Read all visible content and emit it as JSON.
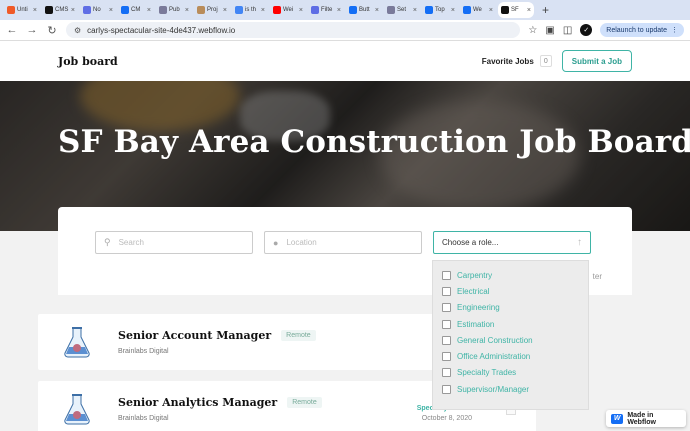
{
  "browser": {
    "tabs": [
      {
        "label": "Unti",
        "color": "#f05a28"
      },
      {
        "label": "CMS",
        "color": "#111111"
      },
      {
        "label": "No",
        "color": "#5f6ee5"
      },
      {
        "label": "CM",
        "color": "#146ef5"
      },
      {
        "label": "Pub",
        "color": "#7a7a9a"
      },
      {
        "label": "Proj",
        "color": "#b98c5a"
      },
      {
        "label": "is th",
        "color": "#4285f4"
      },
      {
        "label": "Wei",
        "color": "#ff0000"
      },
      {
        "label": "Filte",
        "color": "#5f6ee5"
      },
      {
        "label": "Butt",
        "color": "#146ef5"
      },
      {
        "label": "Set",
        "color": "#7a7a9a"
      },
      {
        "label": "Top",
        "color": "#146ef5"
      },
      {
        "label": "We",
        "color": "#146ef5"
      },
      {
        "label": "SF",
        "color": "#111111",
        "active": true
      }
    ],
    "new_tab": "+",
    "url": "carlys-spectacular-site-4de437.webflow.io",
    "relaunch_label": "Relaunch to update",
    "profile_initial": "✓"
  },
  "nav": {
    "brand": "Job board",
    "favorite_label": "Favorite Jobs",
    "favorite_count": "0",
    "submit_label": "Submit a Job"
  },
  "hero": {
    "title": "SF Bay Area Construction Job Board"
  },
  "filters": {
    "search_placeholder": "Search",
    "location_placeholder": "Location",
    "role_placeholder": "Choose a role...",
    "clear_label": "ter"
  },
  "roles": [
    "Carpentry",
    "Electrical",
    "Engineering",
    "Estimation",
    "General Construction",
    "Office Administration",
    "Specialty Trades",
    "Supervisor/Manager"
  ],
  "jobs": [
    {
      "title": "Senior Account Manager",
      "tag": "Remote",
      "company": "Brainlabs Digital",
      "category": "",
      "date": ""
    },
    {
      "title": "Senior Analytics Manager",
      "tag": "Remote",
      "company": "Brainlabs Digital",
      "category": "Specialty Trades",
      "date": "October 8, 2020"
    }
  ],
  "badge": {
    "label": "Made in Webflow",
    "logo": "W"
  },
  "colors": {
    "accent": "#3fb4a6",
    "webflow_blue": "#146ef5"
  }
}
